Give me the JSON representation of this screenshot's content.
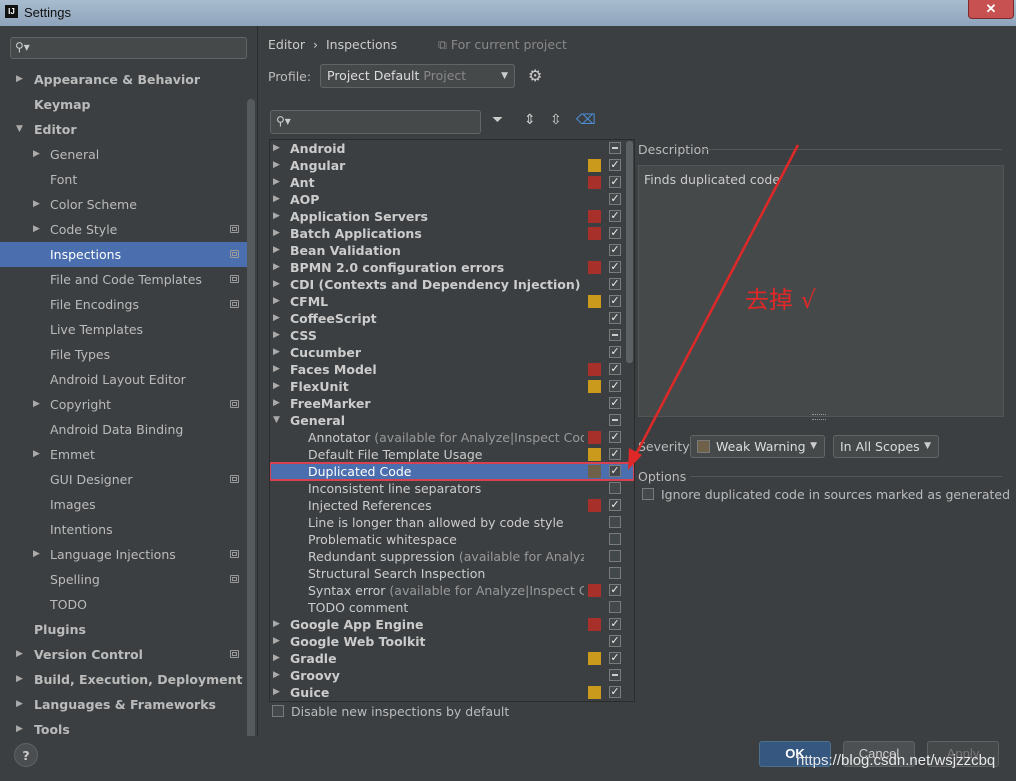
{
  "window": {
    "logo": "IJ",
    "title": "Settings",
    "close_glyph": "✕"
  },
  "sidebar": {
    "items": [
      {
        "label": "Appearance & Behavior",
        "level": 0,
        "arrow": "▶",
        "bold": true
      },
      {
        "label": "Keymap",
        "level": 0,
        "bold": true
      },
      {
        "label": "Editor",
        "level": 0,
        "arrow": "▼",
        "bold": true
      },
      {
        "label": "General",
        "level": 1,
        "arrow": "▶"
      },
      {
        "label": "Font",
        "level": 1
      },
      {
        "label": "Color Scheme",
        "level": 1,
        "arrow": "▶"
      },
      {
        "label": "Code Style",
        "level": 1,
        "arrow": "▶",
        "project": true
      },
      {
        "label": "Inspections",
        "level": 1,
        "project": true,
        "selected": true
      },
      {
        "label": "File and Code Templates",
        "level": 1,
        "project": true
      },
      {
        "label": "File Encodings",
        "level": 1,
        "project": true
      },
      {
        "label": "Live Templates",
        "level": 1
      },
      {
        "label": "File Types",
        "level": 1
      },
      {
        "label": "Android Layout Editor",
        "level": 1
      },
      {
        "label": "Copyright",
        "level": 1,
        "arrow": "▶",
        "project": true
      },
      {
        "label": "Android Data Binding",
        "level": 1
      },
      {
        "label": "Emmet",
        "level": 1,
        "arrow": "▶"
      },
      {
        "label": "GUI Designer",
        "level": 1,
        "project": true
      },
      {
        "label": "Images",
        "level": 1
      },
      {
        "label": "Intentions",
        "level": 1
      },
      {
        "label": "Language Injections",
        "level": 1,
        "arrow": "▶",
        "project": true
      },
      {
        "label": "Spelling",
        "level": 1,
        "project": true
      },
      {
        "label": "TODO",
        "level": 1
      },
      {
        "label": "Plugins",
        "level": 0,
        "bold": true
      },
      {
        "label": "Version Control",
        "level": 0,
        "arrow": "▶",
        "bold": true,
        "project": true
      },
      {
        "label": "Build, Execution, Deployment",
        "level": 0,
        "arrow": "▶",
        "bold": true
      },
      {
        "label": "Languages & Frameworks",
        "level": 0,
        "arrow": "▶",
        "bold": true
      },
      {
        "label": "Tools",
        "level": 0,
        "arrow": "▶",
        "bold": true
      }
    ]
  },
  "breadcrumb": {
    "parent": "Editor",
    "separator": "›",
    "current": "Inspections",
    "scope": "For current project"
  },
  "profile": {
    "label": "Profile:",
    "value": "Project Default",
    "suffix": "Project"
  },
  "colors": {
    "severity_red": "#a8302b",
    "severity_yellow": "#c99a1b",
    "selection": "#4b6eaf",
    "annotation": "#e02828"
  },
  "inspections": [
    {
      "name": "Android",
      "group": true,
      "check": "partial"
    },
    {
      "name": "Angular",
      "group": true,
      "sev": "yellow",
      "check": "on"
    },
    {
      "name": "Ant",
      "group": true,
      "sev": "red",
      "check": "on"
    },
    {
      "name": "AOP",
      "group": true,
      "check": "on"
    },
    {
      "name": "Application Servers",
      "group": true,
      "sev": "red",
      "check": "on"
    },
    {
      "name": "Batch Applications",
      "group": true,
      "sev": "red",
      "check": "on"
    },
    {
      "name": "Bean Validation",
      "group": true,
      "check": "on"
    },
    {
      "name": "BPMN 2.0 configuration errors",
      "group": true,
      "sev": "red",
      "check": "on"
    },
    {
      "name": "CDI (Contexts and Dependency Injection)",
      "group": true,
      "check": "on"
    },
    {
      "name": "CFML",
      "group": true,
      "sev": "yellow",
      "check": "on"
    },
    {
      "name": "CoffeeScript",
      "group": true,
      "check": "on"
    },
    {
      "name": "CSS",
      "group": true,
      "check": "partial"
    },
    {
      "name": "Cucumber",
      "group": true,
      "check": "on"
    },
    {
      "name": "Faces Model",
      "group": true,
      "sev": "red",
      "check": "on"
    },
    {
      "name": "FlexUnit",
      "group": true,
      "sev": "yellow",
      "check": "on"
    },
    {
      "name": "FreeMarker",
      "group": true,
      "check": "on"
    },
    {
      "name": "General",
      "group": true,
      "expanded": true,
      "check": "partial"
    },
    {
      "name": "Annotator",
      "note": " (available for Analyze|Inspect Code)",
      "sev": "red",
      "check": "on"
    },
    {
      "name": "Default File Template Usage",
      "sev": "yellow",
      "check": "on"
    },
    {
      "name": "Duplicated Code",
      "sev": "weak",
      "check": "on",
      "selected": true
    },
    {
      "name": "Inconsistent line separators",
      "check": "off"
    },
    {
      "name": "Injected References",
      "sev": "red",
      "check": "on"
    },
    {
      "name": "Line is longer than allowed by code style",
      "check": "off"
    },
    {
      "name": "Problematic whitespace",
      "check": "off"
    },
    {
      "name": "Redundant suppression",
      "note": " (available for Analyze|Inspect Code)",
      "check": "off"
    },
    {
      "name": "Structural Search Inspection",
      "check": "off"
    },
    {
      "name": "Syntax error",
      "note": " (available for Analyze|Inspect Code)",
      "sev": "red",
      "check": "on"
    },
    {
      "name": "TODO comment",
      "check": "off"
    },
    {
      "name": "Google App Engine",
      "group": true,
      "sev": "red",
      "check": "on"
    },
    {
      "name": "Google Web Toolkit",
      "group": true,
      "check": "on"
    },
    {
      "name": "Gradle",
      "group": true,
      "sev": "yellow",
      "check": "on"
    },
    {
      "name": "Groovy",
      "group": true,
      "check": "partial"
    },
    {
      "name": "Guice",
      "group": true,
      "sev": "yellow",
      "check": "on"
    }
  ],
  "disable_new_label": "Disable new inspections by default",
  "description": {
    "label": "Description",
    "text": "Finds duplicated code"
  },
  "severity": {
    "label": "Severity:",
    "value": "Weak Warning",
    "scope": "In All Scopes"
  },
  "options": {
    "label": "Options",
    "checkbox_label": "Ignore duplicated code in sources marked as generated"
  },
  "annotation": {
    "text": "去掉 √"
  },
  "buttons": {
    "help": "?",
    "ok": "OK",
    "cancel": "Cancel",
    "apply": "Apply"
  },
  "watermark": "https://blog.csdn.net/wsjzzcbq"
}
